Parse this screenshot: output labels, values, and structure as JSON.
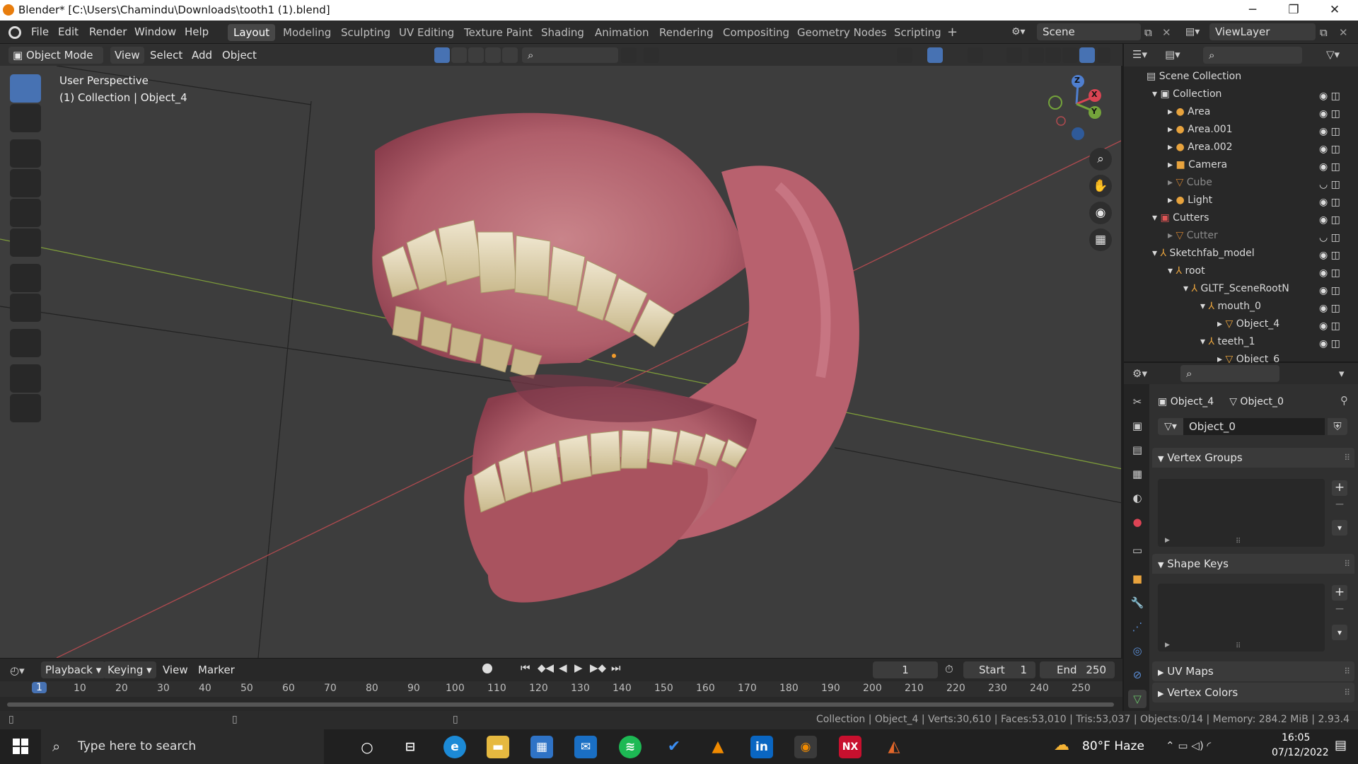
{
  "window": {
    "title": "Blender* [C:\\Users\\Chamindu\\Downloads\\tooth1 (1).blend]"
  },
  "menus": [
    "File",
    "Edit",
    "Render",
    "Window",
    "Help"
  ],
  "workspaces": [
    "Layout",
    "Modeling",
    "Sculpting",
    "UV Editing",
    "Texture Paint",
    "Shading",
    "Animation",
    "Rendering",
    "Compositing",
    "Geometry Nodes",
    "Scripting"
  ],
  "scene_name": "Scene",
  "view_layer": "ViewLayer",
  "viewport": {
    "mode": "Object Mode",
    "menus": [
      "View",
      "Select",
      "Add",
      "Object"
    ],
    "perspective_label": "User Perspective",
    "collection_label": "(1) Collection | Object_4",
    "axes": {
      "x": "X",
      "y": "Y",
      "z": "Z"
    }
  },
  "outliner": {
    "root": "Scene Collection",
    "items": [
      {
        "label": "Collection"
      },
      {
        "label": "Area"
      },
      {
        "label": "Area.001"
      },
      {
        "label": "Area.002"
      },
      {
        "label": "Camera"
      },
      {
        "label": "Cube"
      },
      {
        "label": "Light"
      },
      {
        "label": "Cutters"
      },
      {
        "label": "Cutter"
      },
      {
        "label": "Sketchfab_model"
      },
      {
        "label": "root"
      },
      {
        "label": "GLTF_SceneRootN"
      },
      {
        "label": "mouth_0"
      },
      {
        "label": "Object_4"
      },
      {
        "label": "teeth_1"
      },
      {
        "label": "Object_6"
      }
    ]
  },
  "properties": {
    "object_name": "Object_4",
    "mesh_name": "Object_0",
    "data_field": "Object_0",
    "panels": {
      "vertex_groups": "Vertex Groups",
      "shape_keys": "Shape Keys",
      "uv_maps": "UV Maps",
      "vertex_colors": "Vertex Colors"
    }
  },
  "timeline": {
    "menus": [
      "Playback",
      "Keying",
      "View",
      "Marker"
    ],
    "current_frame": "1",
    "start_label": "Start",
    "start": "1",
    "end_label": "End",
    "end": "250",
    "ruler": [
      "1",
      "10",
      "20",
      "30",
      "40",
      "50",
      "60",
      "70",
      "80",
      "90",
      "100",
      "110",
      "120",
      "130",
      "140",
      "150",
      "160",
      "170",
      "180",
      "190",
      "200",
      "210",
      "220",
      "230",
      "240",
      "250"
    ]
  },
  "status_bar": "Collection | Object_4 | Verts:30,610 | Faces:53,010 | Tris:53,037 | Objects:0/14 | Memory: 284.2 MiB | 2.93.4",
  "taskbar": {
    "search_placeholder": "Type here to search",
    "weather": "80°F  Haze",
    "time": "16:05",
    "date": "07/12/2022"
  }
}
